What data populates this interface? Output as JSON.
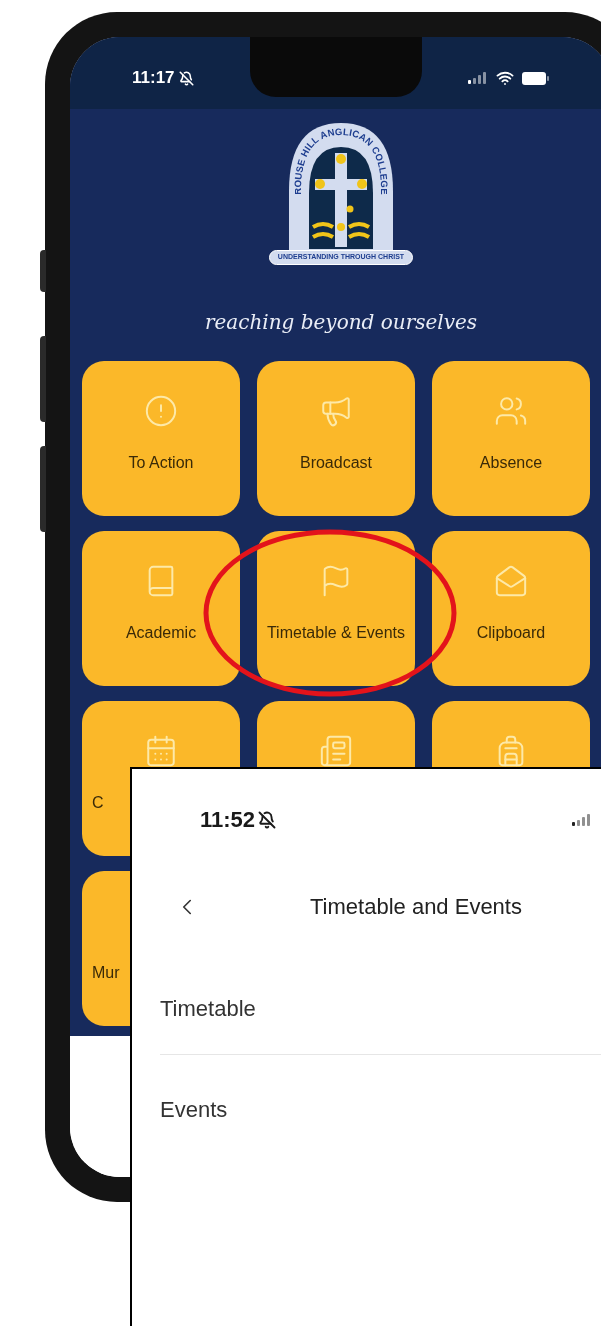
{
  "phone": {
    "status_bar": {
      "time": "11:17",
      "muted": true
    },
    "crest": {
      "name": "ROUSE HILL ANGLICAN COLLEGE",
      "motto": "UNDERSTANDING THROUGH CHRIST"
    },
    "tagline": "reaching beyond ourselves",
    "tiles": [
      {
        "label": "To Action",
        "circled": false
      },
      {
        "label": "Broadcast",
        "circled": false
      },
      {
        "label": "Absence",
        "circled": false
      },
      {
        "label": "Academic",
        "circled": false
      },
      {
        "label": "Timetable & Events",
        "circled": true
      },
      {
        "label": "Clipboard",
        "circled": false
      },
      {
        "label": "C",
        "circled": false
      },
      {
        "circled": false
      },
      {
        "circled": false
      },
      {
        "label": "Mur",
        "circled": false
      }
    ]
  },
  "overlay": {
    "status_bar": {
      "time": "11:52",
      "muted": true
    },
    "title": "Timetable and Events",
    "items": [
      {
        "label": "Timetable"
      },
      {
        "label": "Events"
      }
    ]
  }
}
